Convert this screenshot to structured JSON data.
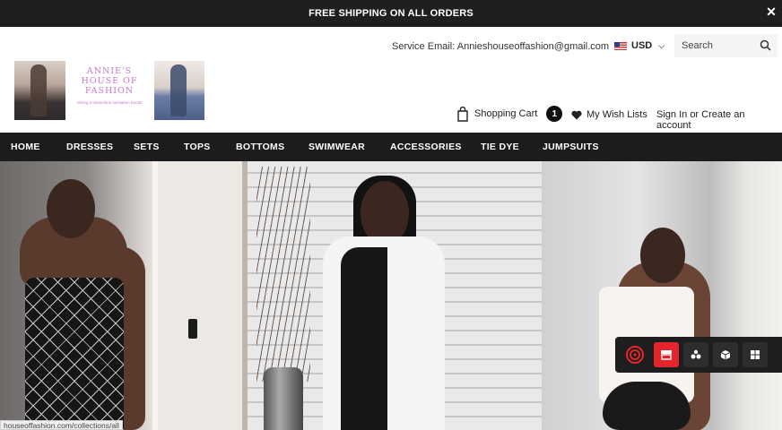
{
  "announcement": {
    "text": "FREE SHIPPING ON ALL ORDERS",
    "close": "✕"
  },
  "header": {
    "service_email": "Service Email: Annieshouseoffashion@gmail.com",
    "currency": "USD",
    "search_placeholder": "Search",
    "logo": {
      "line1": "ANNIE'S",
      "line2": "HOUSE OF",
      "line3": "FASHION",
      "tagline": "Giving a streamline sensation trendz"
    },
    "cart_label": "Shopping Cart",
    "cart_count": "1",
    "wishlist_label": "My Wish Lists",
    "sign_in": "Sign In",
    "or": "or",
    "create_account": "Create an account"
  },
  "nav": [
    "HOME",
    "DRESSES",
    "SETS",
    "TOPS",
    "BOTTOMS",
    "SWIMWEAR",
    "ACCESSORIES",
    "TIE DYE",
    "JUMPSUITS"
  ],
  "status_url": "houseoffashion.com/collections/all",
  "colors": {
    "accent": "#e4262c",
    "nav_bg": "#1c1c1c",
    "logo_pink": "#c777c9"
  },
  "toolbar_icons": [
    "target-icon",
    "store-icon",
    "share-icon",
    "box-icon",
    "grid-icon"
  ]
}
